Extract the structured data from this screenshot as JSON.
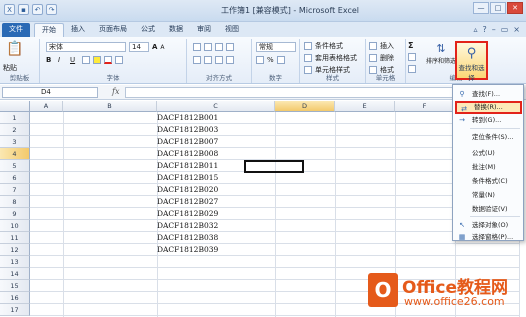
{
  "window": {
    "title": "工作簿1 [兼容模式] - Microsoft Excel",
    "controls": [
      "—",
      "□",
      "✕"
    ]
  },
  "tabs": [
    "文件",
    "开始",
    "插入",
    "页面布局",
    "公式",
    "数据",
    "审阅",
    "视图"
  ],
  "ribbon": {
    "clipboard": {
      "paste": "粘贴",
      "label": "剪贴板"
    },
    "font": {
      "name": "宋体",
      "size": "14",
      "grow": "A",
      "shrink": "A",
      "bold": "B",
      "italic": "I",
      "underline": "U",
      "label": "字体"
    },
    "alignment": {
      "label": "对齐方式"
    },
    "number": {
      "format": "常规",
      "percent": "%",
      "label": "数字"
    },
    "styles": {
      "conditional": "条件格式",
      "table": "套用表格格式",
      "cell": "单元格样式",
      "label": "样式"
    },
    "cells": {
      "insert": "插入",
      "delete": "删除",
      "format": "格式",
      "label": "单元格"
    },
    "editing": {
      "sum": "Σ",
      "sort": "排序和筛选",
      "find": "查找和选择",
      "label": "编辑"
    }
  },
  "formula_bar": {
    "cell_ref": "D4",
    "fx": "fx",
    "value": ""
  },
  "columns": [
    "A",
    "B",
    "C",
    "D",
    "E",
    "F",
    "G"
  ],
  "rows": [
    "1",
    "2",
    "3",
    "4",
    "5",
    "6",
    "7",
    "8",
    "9",
    "10",
    "11",
    "12",
    "13",
    "14",
    "15",
    "16",
    "17"
  ],
  "selected_column": "D",
  "selected_row": "4",
  "cells_c": [
    "DACF1812B001",
    "DACF1812B003",
    "DACF1812B007",
    "DACF1812B008",
    "DACF1812B011",
    "DACF1812B015",
    "DACF1812B020",
    "DACF1812B027",
    "DACF1812B029",
    "DACF1812B032",
    "DACF1812B038",
    "DACF1812B039"
  ],
  "menu": {
    "items": [
      {
        "icon": "binoculars-icon",
        "glyph": "⚲",
        "label": "查找(F)..."
      },
      {
        "icon": "replace-icon",
        "glyph": "⇄",
        "label": "替换(R)..."
      },
      {
        "icon": "goto-icon",
        "glyph": "→",
        "label": "转到(G)..."
      },
      {
        "icon": "",
        "glyph": "",
        "label": "定位条件(S)..."
      },
      {
        "icon": "",
        "glyph": "",
        "label": "公式(U)"
      },
      {
        "icon": "",
        "glyph": "",
        "label": "批注(M)"
      },
      {
        "icon": "",
        "glyph": "",
        "label": "条件格式(C)"
      },
      {
        "icon": "",
        "glyph": "",
        "label": "常量(N)"
      },
      {
        "icon": "",
        "glyph": "",
        "label": "数据验证(V)"
      },
      {
        "icon": "cursor-icon",
        "glyph": "↖",
        "label": "选择对象(O)"
      },
      {
        "icon": "selection-pane-icon",
        "glyph": "▦",
        "label": "选择窗格(P)..."
      }
    ]
  },
  "watermark": {
    "brand": "Office教程网",
    "url": "www.office26.com",
    "logo_letter": "O"
  },
  "colors": {
    "highlight": "#e2231a",
    "file_tab": "#2b6ab5",
    "watermark": "#e55a1a"
  }
}
